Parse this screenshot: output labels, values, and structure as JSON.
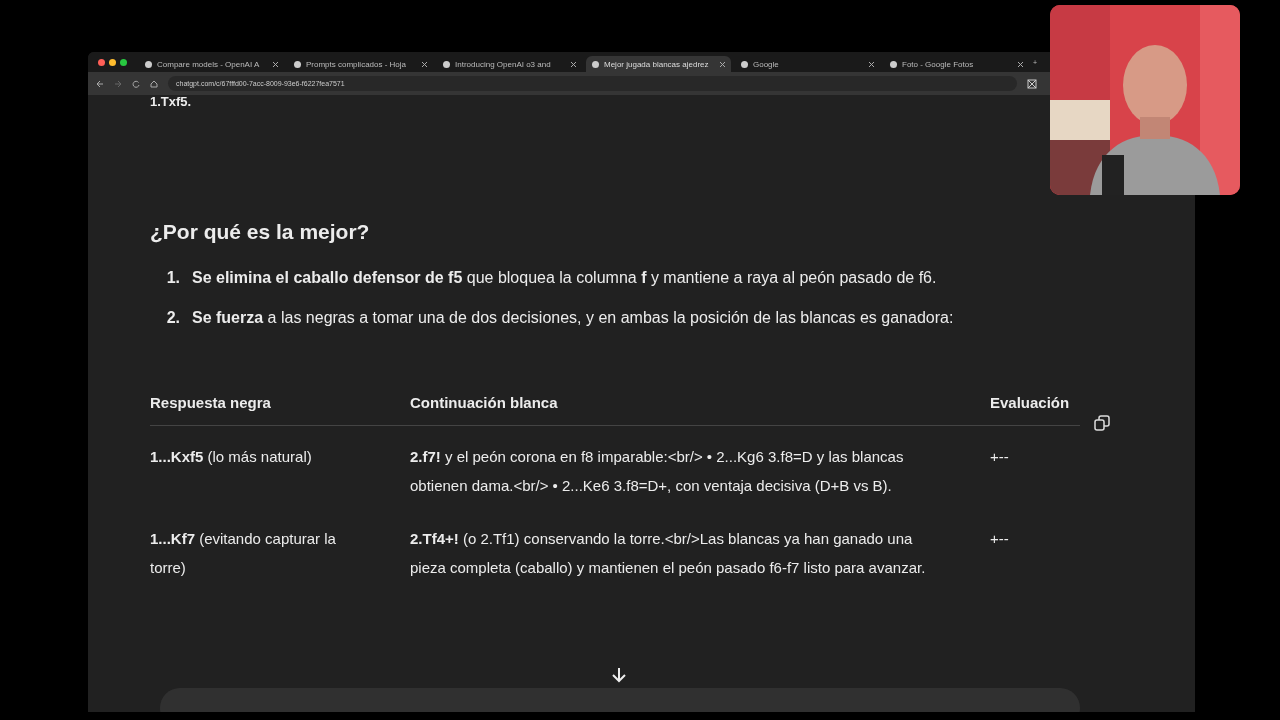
{
  "browser": {
    "tabs": [
      {
        "title": "Compare models - OpenAI A",
        "selected": false
      },
      {
        "title": "Prompts complicados - Hoja",
        "selected": false
      },
      {
        "title": "Introducing OpenAI o3 and",
        "selected": false
      },
      {
        "title": "Mejor jugada blancas ajedrez",
        "selected": true
      },
      {
        "title": "Google",
        "selected": false
      },
      {
        "title": "Foto - Google Fotos",
        "selected": false
      }
    ],
    "new_tab": "+",
    "url": "chatgpt.com/c/67fffd00-7acc-8009-93e6-f6227fea7571"
  },
  "chat": {
    "previous_line": "1.Txf5.",
    "heading": "¿Por qué es la mejor?",
    "reasons": [
      {
        "number": "1.",
        "text": "**Se elimina el caballo defensor de f5** que bloquea la columna **f** y mantiene a raya al peón pasado de f6."
      },
      {
        "number": "2.",
        "text": "**Se fuerza** a las negras a tomar una de dos decisiones, y en ambas la posición de las blancas es ganadora:"
      }
    ],
    "table": {
      "columns": [
        "Respuesta negra",
        "Continuación blanca",
        "Evaluación"
      ],
      "rows": [
        [
          "**1...Kxf5** (lo más natural)",
          "**2.f7!** y el peón corona en f8 imparable:<br/>   • 2...Kg6 3.f8=D y las blancas obtienen dama.<br/>   • 2...Ke6 3.f8=D+, con ventaja decisiva (D+B vs B).",
          "+--"
        ],
        [
          "**1...Kf7** (evitando capturar la torre)",
          "**2.Tf4+!** (o 2.Tf1) conservando la torre.<br/>Las blancas ya han ganado una pieza completa (caballo) y mantienen el peón pasado f6-f7 listo para avanzar.",
          "+--"
        ]
      ]
    }
  }
}
